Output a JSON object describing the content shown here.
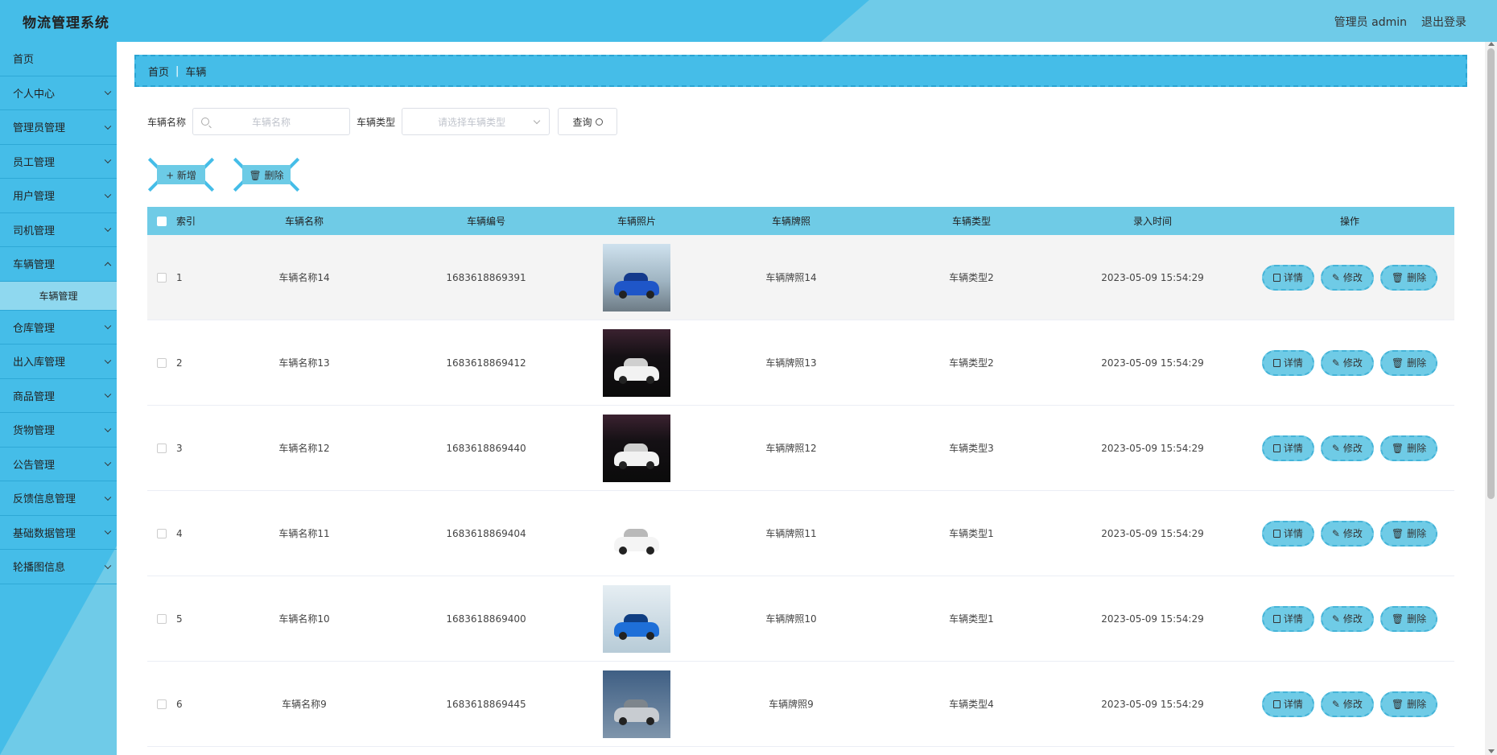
{
  "header": {
    "title": "物流管理系统",
    "user": "管理员 admin",
    "logout": "退出登录"
  },
  "sidebar": {
    "items": [
      {
        "label": "首页",
        "expandable": false
      },
      {
        "label": "个人中心",
        "expandable": true
      },
      {
        "label": "管理员管理",
        "expandable": true
      },
      {
        "label": "员工管理",
        "expandable": true
      },
      {
        "label": "用户管理",
        "expandable": true
      },
      {
        "label": "司机管理",
        "expandable": true
      },
      {
        "label": "车辆管理",
        "expandable": true,
        "expanded": true
      },
      {
        "label": "仓库管理",
        "expandable": true
      },
      {
        "label": "出入库管理",
        "expandable": true
      },
      {
        "label": "商品管理",
        "expandable": true
      },
      {
        "label": "货物管理",
        "expandable": true
      },
      {
        "label": "公告管理",
        "expandable": true
      },
      {
        "label": "反馈信息管理",
        "expandable": true
      },
      {
        "label": "基础数据管理",
        "expandable": true
      },
      {
        "label": "轮播图信息",
        "expandable": true
      }
    ],
    "sub_item": "车辆管理"
  },
  "breadcrumb": {
    "home": "首页",
    "current": "车辆"
  },
  "search": {
    "name_label": "车辆名称",
    "name_placeholder": "车辆名称",
    "type_label": "车辆类型",
    "type_placeholder": "请选择车辆类型",
    "query_button": "查询"
  },
  "actions": {
    "add": "+ 新增",
    "delete": "删除"
  },
  "table": {
    "headers": [
      "索引",
      "车辆名称",
      "车辆编号",
      "车辆照片",
      "车辆牌照",
      "车辆类型",
      "录入时间",
      "操作"
    ],
    "op_labels": {
      "detail": "详情",
      "edit": "修改",
      "delete": "删除"
    },
    "rows": [
      {
        "index": "1",
        "name": "车辆名称14",
        "code": "1683618869391",
        "photo": "blue-sports-car-on-road",
        "plate": "车辆牌照14",
        "type": "车辆类型2",
        "time": "2023-05-09 15:54:29"
      },
      {
        "index": "2",
        "name": "车辆名称13",
        "code": "1683618869412",
        "photo": "white-sedan-dark-background",
        "plate": "车辆牌照13",
        "type": "车辆类型2",
        "time": "2023-05-09 15:54:29"
      },
      {
        "index": "3",
        "name": "车辆名称12",
        "code": "1683618869440",
        "photo": "white-sedan-dark-background",
        "plate": "车辆牌照12",
        "type": "车辆类型3",
        "time": "2023-05-09 15:54:29"
      },
      {
        "index": "4",
        "name": "车辆名称11",
        "code": "1683618869404",
        "photo": "white-suv-white-background",
        "plate": "车辆牌照11",
        "type": "车辆类型1",
        "time": "2023-05-09 15:54:29"
      },
      {
        "index": "5",
        "name": "车辆名称10",
        "code": "1683618869400",
        "photo": "blue-sports-car-light-background",
        "plate": "车辆牌照10",
        "type": "车辆类型1",
        "time": "2023-05-09 15:54:29"
      },
      {
        "index": "6",
        "name": "车辆名称9",
        "code": "1683618869445",
        "photo": "silver-suv-blue-background",
        "plate": "车辆牌照9",
        "type": "车辆类型4",
        "time": "2023-05-09 15:54:29"
      }
    ]
  },
  "colors": {
    "primary": "#45bde8",
    "header_accent": "#6fcbe8",
    "table_header": "#6fcbe6"
  }
}
